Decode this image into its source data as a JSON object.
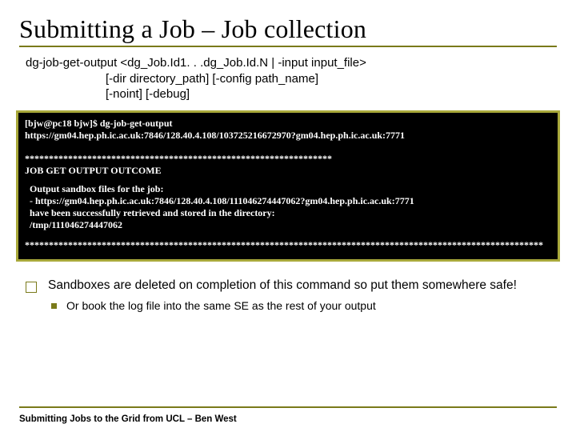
{
  "title": "Submitting a Job – Job collection",
  "usage": "dg-job-get-output <dg_Job.Id1. . .dg_Job.Id.N | -input input_file>\n                        [-dir directory_path] [-config path_name]\n                        [-noint] [-debug]",
  "terminal": {
    "cmd_line1": "[bjw@pc18 bjw]$ dg-job-get-output",
    "cmd_line2": "https://gm04.hep.ph.ic.ac.uk:7846/128.40.4.108/103725216672970?gm04.hep.ph.ic.ac.uk:7771",
    "stars_top": "****************************************************************",
    "outcome_label": "JOB GET OUTPUT OUTCOME",
    "body_l1": "Output sandbox files for the job:",
    "body_l2": "- https://gm04.hep.ph.ic.ac.uk:7846/128.40.4.108/111046274447062?gm04.hep.ph.ic.ac.uk:7771",
    "body_l3": "have been successfully retrieved and stored in the directory:",
    "body_l4": "/tmp/111046274447062",
    "stars_bottom": "************************************************************************************************************"
  },
  "bullets": {
    "level1": "Sandboxes are deleted on completion of this command so put them somewhere safe!",
    "level2": "Or book the log file into the same SE as the rest of your output"
  },
  "footer": "Submitting Jobs to the Grid from UCL – Ben West"
}
